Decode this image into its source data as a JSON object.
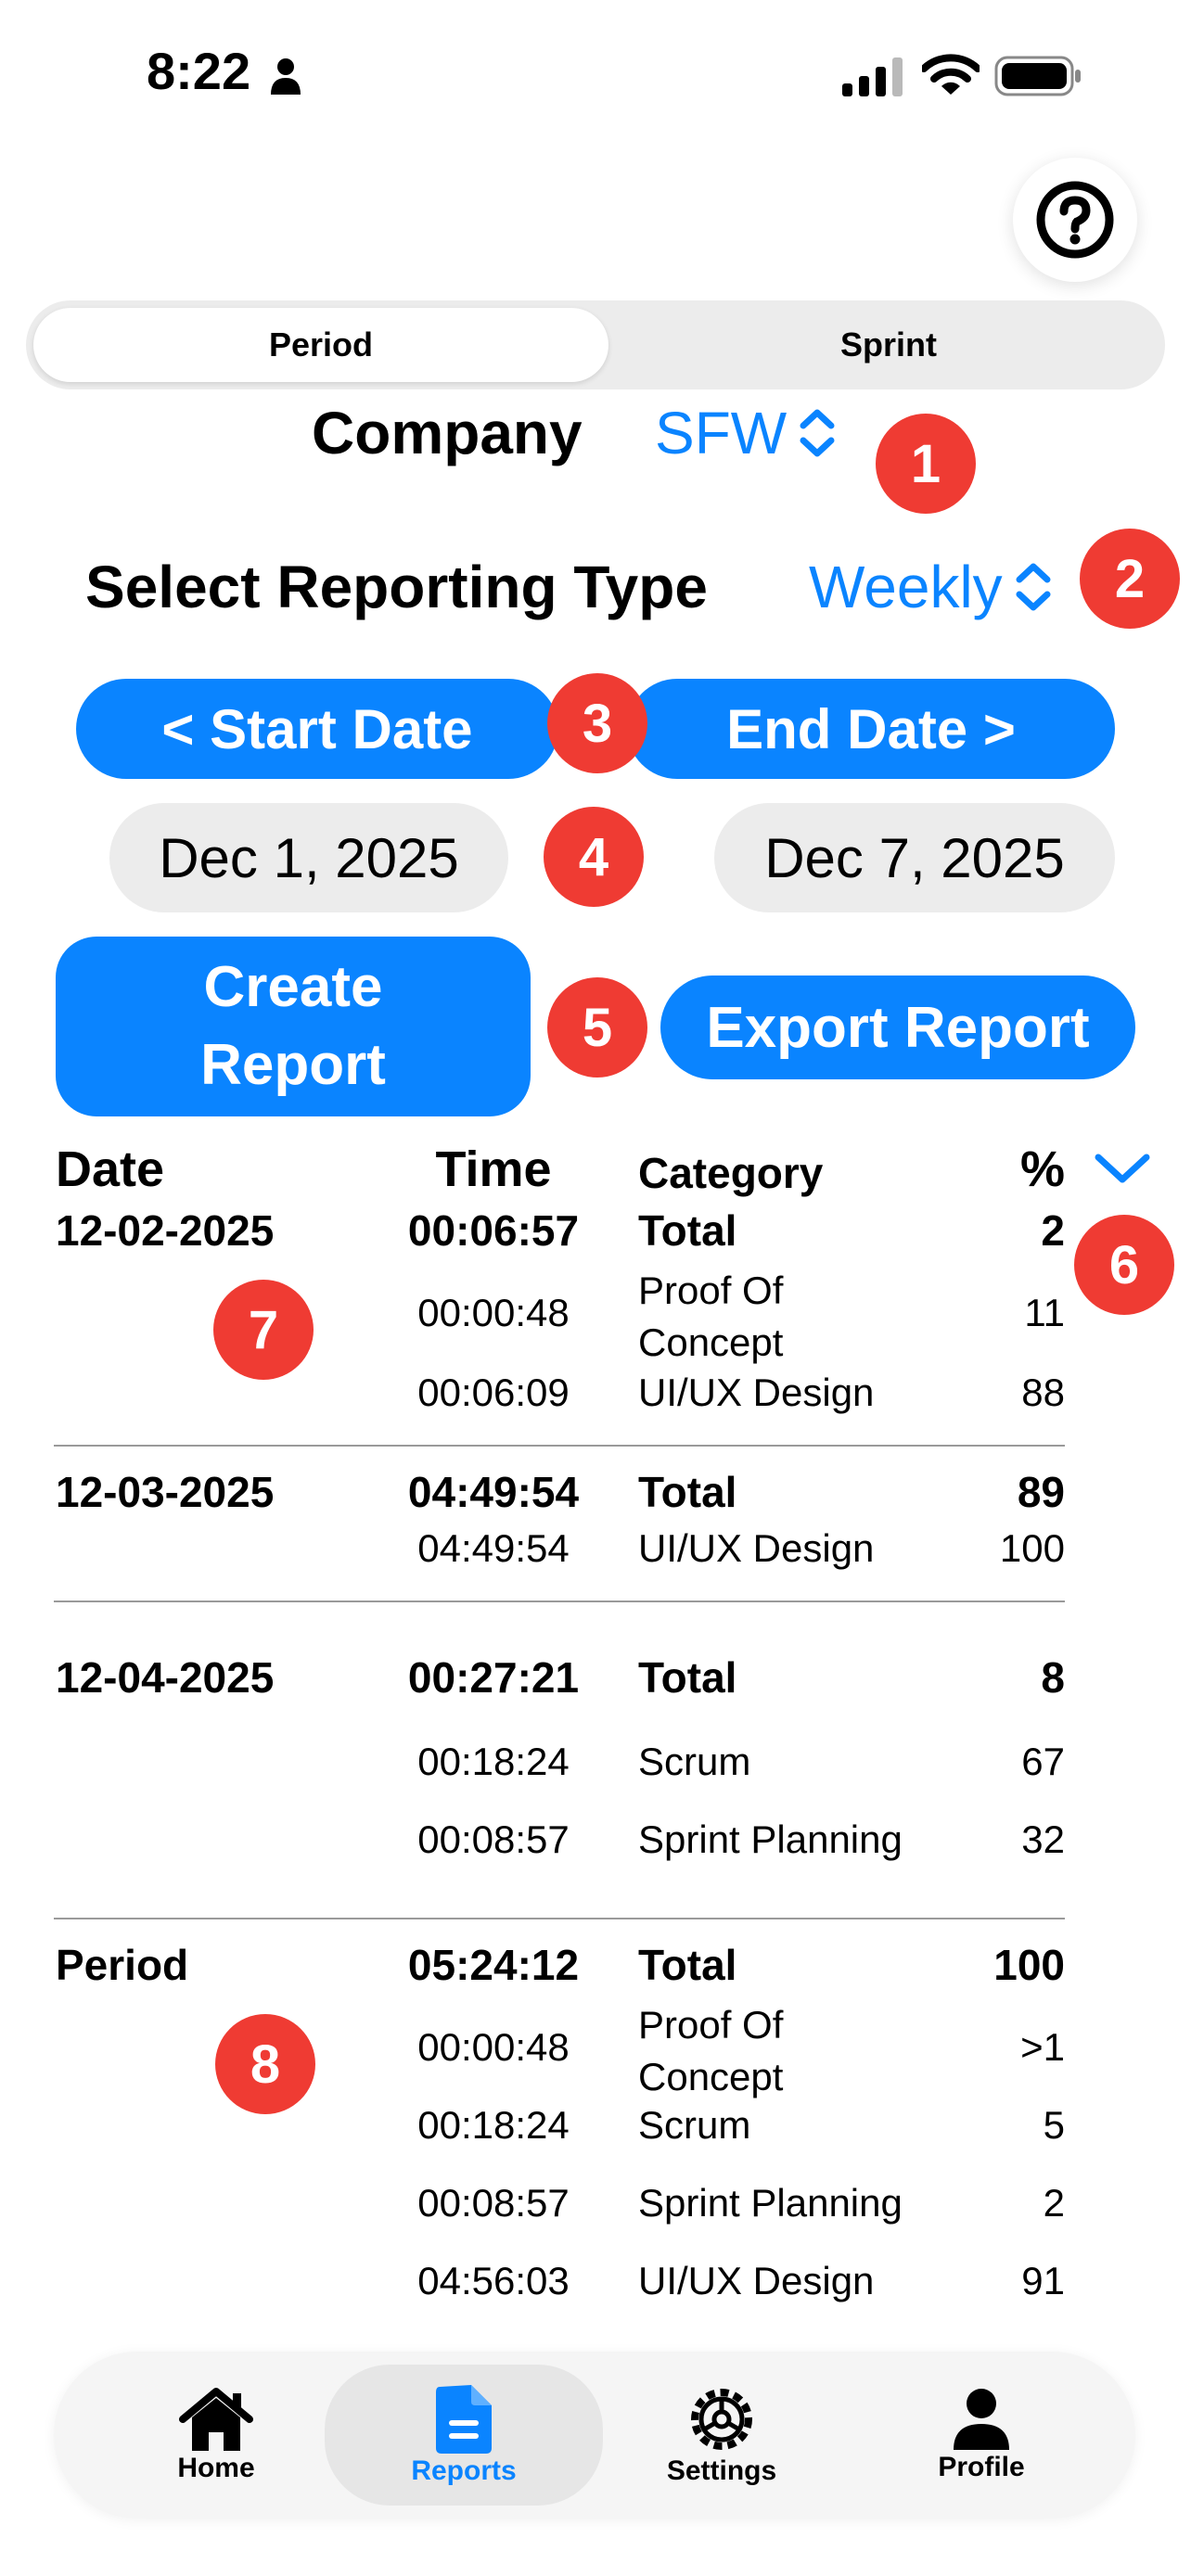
{
  "status_bar": {
    "time": "8:22"
  },
  "segments": {
    "period": "Period",
    "sprint": "Sprint"
  },
  "company": {
    "label": "Company",
    "value": "SFW"
  },
  "reporting": {
    "label": "Select Reporting Type",
    "value": "Weekly"
  },
  "dates": {
    "start_button": "<  Start Date",
    "end_button": "End Date  >",
    "start_value": "Dec 1, 2025",
    "end_value": "Dec 7, 2025"
  },
  "actions": {
    "create": "Create Report",
    "export": "Export Report"
  },
  "badges": [
    "1",
    "2",
    "3",
    "4",
    "5",
    "6",
    "7",
    "8"
  ],
  "table": {
    "headers": {
      "date": "Date",
      "time": "Time",
      "category": "Category",
      "percent": "%"
    },
    "groups": [
      {
        "date": "12-02-2025",
        "rows": [
          {
            "time": "00:06:57",
            "category": "Total",
            "percent": "2"
          },
          {
            "time": "00:00:48",
            "category": "Proof Of Concept",
            "percent": "11"
          },
          {
            "time": "00:06:09",
            "category": "UI/UX Design",
            "percent": "88"
          }
        ]
      },
      {
        "date": "12-03-2025",
        "rows": [
          {
            "time": "04:49:54",
            "category": "Total",
            "percent": "89"
          },
          {
            "time": "04:49:54",
            "category": "UI/UX Design",
            "percent": "100"
          }
        ]
      },
      {
        "date": "12-04-2025",
        "rows": [
          {
            "time": "00:27:21",
            "category": "Total",
            "percent": "8"
          },
          {
            "time": "00:18:24",
            "category": "Scrum",
            "percent": "67"
          },
          {
            "time": "00:08:57",
            "category": "Sprint Planning",
            "percent": "32"
          }
        ]
      },
      {
        "date": "Period",
        "rows": [
          {
            "time": "05:24:12",
            "category": "Total",
            "percent": "100"
          },
          {
            "time": "00:00:48",
            "category": "Proof Of Concept",
            "percent": ">1"
          },
          {
            "time": "00:18:24",
            "category": "Scrum",
            "percent": "5"
          },
          {
            "time": "00:08:57",
            "category": "Sprint Planning",
            "percent": "2"
          },
          {
            "time": "04:56:03",
            "category": "UI/UX Design",
            "percent": "91"
          }
        ]
      }
    ]
  },
  "tabs": [
    {
      "label": "Home",
      "icon": "house-icon"
    },
    {
      "label": "Reports",
      "icon": "document-icon"
    },
    {
      "label": "Settings",
      "icon": "gear-icon"
    },
    {
      "label": "Profile",
      "icon": "person-icon"
    }
  ],
  "colors": {
    "accent": "#0a84ff",
    "badge": "#ef3b33"
  }
}
